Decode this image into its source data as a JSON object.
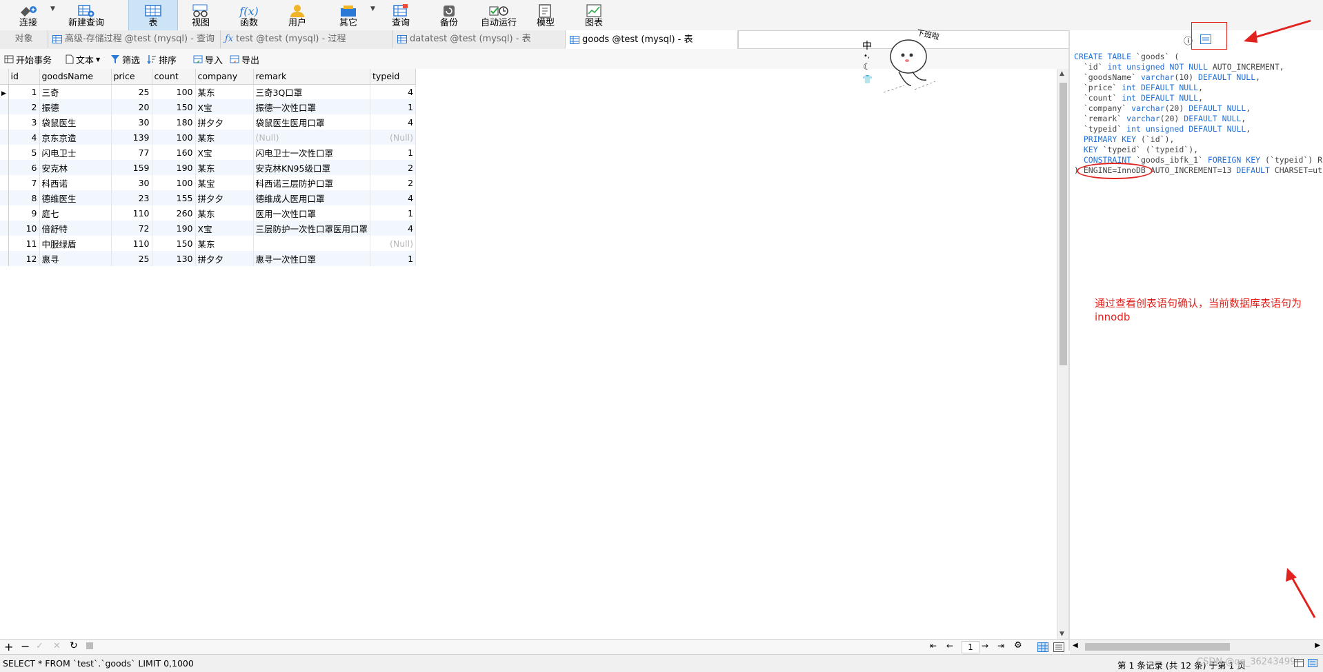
{
  "ribbon": {
    "buttons": [
      {
        "label": "连接",
        "icon": "connect-icon"
      },
      {
        "label": "新建查询",
        "icon": "new-query-icon"
      },
      {
        "label": "表",
        "icon": "table-icon"
      },
      {
        "label": "视图",
        "icon": "view-icon"
      },
      {
        "label": "函数",
        "icon": "function-icon"
      },
      {
        "label": "用户",
        "icon": "user-icon"
      },
      {
        "label": "其它",
        "icon": "other-icon"
      },
      {
        "label": "查询",
        "icon": "query-icon"
      },
      {
        "label": "备份",
        "icon": "backup-icon"
      },
      {
        "label": "自动运行",
        "icon": "auto-run-icon"
      },
      {
        "label": "模型",
        "icon": "model-icon"
      },
      {
        "label": "图表",
        "icon": "chart-icon"
      }
    ],
    "function_glyph": "f(x)"
  },
  "tabs": [
    {
      "label": "对象"
    },
    {
      "label": "高级-存储过程 @test (mysql) - 查询"
    },
    {
      "label": "test @test (mysql) - 过程"
    },
    {
      "label": "datatest @test (mysql) - 表"
    },
    {
      "label": "goods @test (mysql) - 表"
    }
  ],
  "toolbar": {
    "begin_transaction": "开始事务",
    "text": "文本",
    "filter": "筛选",
    "sort": "排序",
    "import": "导入",
    "export": "导出"
  },
  "sticker": {
    "side_chars": [
      "中",
      "•,"
    ],
    "bubble": "下班啦"
  },
  "table": {
    "columns": [
      "id",
      "goodsName",
      "price",
      "count",
      "company",
      "remark",
      "typeid"
    ],
    "rows": [
      {
        "id": "1",
        "goodsName": "三奇",
        "price": "25",
        "count": "100",
        "company": "某东",
        "remark": "三奇3Q口罩",
        "typeid": "4"
      },
      {
        "id": "2",
        "goodsName": "振德",
        "price": "20",
        "count": "150",
        "company": "X宝",
        "remark": "振德一次性口罩",
        "typeid": "1"
      },
      {
        "id": "3",
        "goodsName": "袋鼠医生",
        "price": "30",
        "count": "180",
        "company": "拼夕夕",
        "remark": "袋鼠医生医用口罩",
        "typeid": "4"
      },
      {
        "id": "4",
        "goodsName": "京东京造",
        "price": "139",
        "count": "100",
        "company": "某东",
        "remark": "(Null)",
        "typeid": "(Null)"
      },
      {
        "id": "5",
        "goodsName": "闪电卫士",
        "price": "77",
        "count": "160",
        "company": "X宝",
        "remark": "闪电卫士一次性口罩",
        "typeid": "1"
      },
      {
        "id": "6",
        "goodsName": "安克林",
        "price": "159",
        "count": "190",
        "company": "某东",
        "remark": "安克林KN95级口罩",
        "typeid": "2"
      },
      {
        "id": "7",
        "goodsName": "科西诺",
        "price": "30",
        "count": "100",
        "company": "某宝",
        "remark": "科西诺三层防护口罩",
        "typeid": "2"
      },
      {
        "id": "8",
        "goodsName": "德维医生",
        "price": "23",
        "count": "155",
        "company": "拼夕夕",
        "remark": "德维成人医用口罩",
        "typeid": "4"
      },
      {
        "id": "9",
        "goodsName": "庭七",
        "price": "110",
        "count": "260",
        "company": "某东",
        "remark": "医用一次性口罩",
        "typeid": "1"
      },
      {
        "id": "10",
        "goodsName": "倍舒特",
        "price": "72",
        "count": "190",
        "company": "X宝",
        "remark": "三层防护一次性口罩医用口罩",
        "typeid": "4"
      },
      {
        "id": "11",
        "goodsName": "中服绿盾",
        "price": "110",
        "count": "150",
        "company": "某东",
        "remark": "",
        "typeid": "(Null)"
      },
      {
        "id": "12",
        "goodsName": "惠寻",
        "price": "25",
        "count": "130",
        "company": "拼夕夕",
        "remark": "惠寻一次性口罩",
        "typeid": "1"
      }
    ]
  },
  "ddl": {
    "lines": [
      "CREATE TABLE `goods` (",
      "  `id` int unsigned NOT NULL AUTO_INCREMENT,",
      "  `goodsName` varchar(10) DEFAULT NULL,",
      "  `price` int DEFAULT NULL,",
      "  `count` int DEFAULT NULL,",
      "  `company` varchar(20) DEFAULT NULL,",
      "  `remark` varchar(20) DEFAULT NULL,",
      "  `typeid` int unsigned DEFAULT NULL,",
      "  PRIMARY KEY (`id`),",
      "  KEY `typeid` (`typeid`),",
      "  CONSTRAINT `goods_ibfk_1` FOREIGN KEY (`typeid`) R",
      ") ENGINE=InnoDB AUTO_INCREMENT=13 DEFAULT CHARSET=ut"
    ],
    "note": "通过查看创表语句确认，当前数据库表语句为innodb"
  },
  "pager": {
    "page": "1"
  },
  "status": {
    "sql": "SELECT * FROM `test`.`goods` LIMIT 0,1000",
    "records": "第 1 条记录 (共 12 条) 于第 1 页",
    "watermark": "CSDN @qq_36243499"
  },
  "colors": {
    "accent": "#1f6fd8",
    "annotation": "#e0231e",
    "active_tab": "#cde3f6"
  }
}
